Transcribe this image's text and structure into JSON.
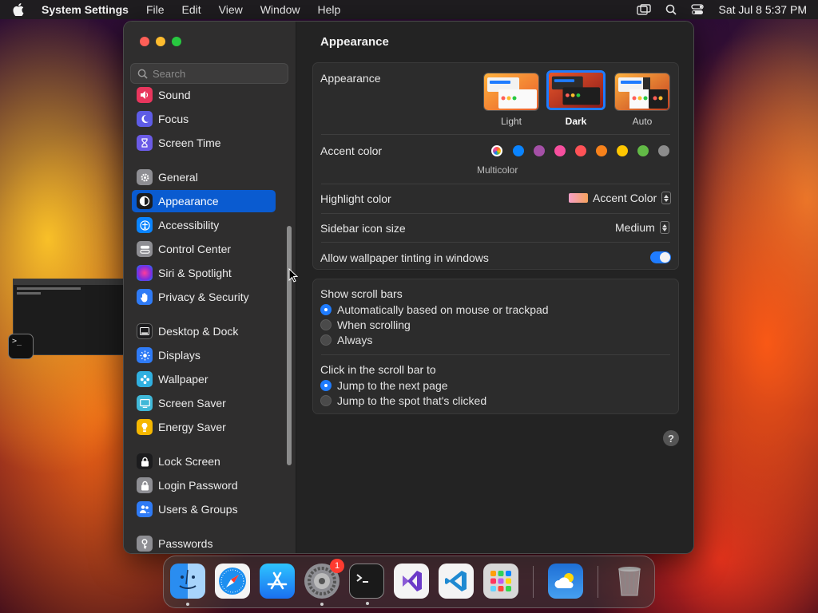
{
  "menubar": {
    "app_name": "System Settings",
    "items": [
      "File",
      "Edit",
      "View",
      "Window",
      "Help"
    ],
    "clock": "Sat Jul 8  5:37 PM"
  },
  "sidebar": {
    "search_placeholder": "Search",
    "items": [
      {
        "label": "Sound",
        "icon": "speaker-icon",
        "color": "#e8365d"
      },
      {
        "label": "Focus",
        "icon": "moon-icon",
        "color": "#5e5ce6"
      },
      {
        "label": "Screen Time",
        "icon": "hourglass-icon",
        "color": "#6b5be6"
      },
      {
        "label": "General",
        "icon": "gear-icon",
        "color": "#8e8e93"
      },
      {
        "label": "Appearance",
        "icon": "appearance-icon",
        "color": "#1c1c1e"
      },
      {
        "label": "Accessibility",
        "icon": "accessibility-icon",
        "color": "#0a84ff"
      },
      {
        "label": "Control Center",
        "icon": "control-center-icon",
        "color": "#8e8e93"
      },
      {
        "label": "Siri & Spotlight",
        "icon": "siri-icon",
        "color": "#b44cd6"
      },
      {
        "label": "Privacy & Security",
        "icon": "hand-icon",
        "color": "#2f7bf6"
      },
      {
        "label": "Desktop & Dock",
        "icon": "dock-icon",
        "color": "#1c1c1e"
      },
      {
        "label": "Displays",
        "icon": "displays-icon",
        "color": "#2f7bf6"
      },
      {
        "label": "Wallpaper",
        "icon": "wallpaper-icon",
        "color": "#30b0e0"
      },
      {
        "label": "Screen Saver",
        "icon": "screen-saver-icon",
        "color": "#40b8d8"
      },
      {
        "label": "Energy Saver",
        "icon": "battery-icon",
        "color": "#f5b700"
      },
      {
        "label": "Lock Screen",
        "icon": "lock-icon",
        "color": "#1c1c1e"
      },
      {
        "label": "Login Password",
        "icon": "lock-key-icon",
        "color": "#8e8e93"
      },
      {
        "label": "Users & Groups",
        "icon": "users-icon",
        "color": "#2f7bf6"
      },
      {
        "label": "Passwords",
        "icon": "key-icon",
        "color": "#8e8e93"
      }
    ],
    "selected": "Appearance"
  },
  "main": {
    "title": "Appearance",
    "appearance": {
      "label": "Appearance",
      "options": [
        "Light",
        "Dark",
        "Auto"
      ],
      "selected": "Dark"
    },
    "accent": {
      "label": "Accent color",
      "multicolor_label": "Multicolor",
      "colors": [
        "multicolor",
        "#0a84ff",
        "#a550a7",
        "#f74f9e",
        "#ff5257",
        "#f7821b",
        "#ffc600",
        "#62ba46",
        "#8c8c8c"
      ]
    },
    "highlight": {
      "label": "Highlight color",
      "value": "Accent Color"
    },
    "sidebar_icon_size": {
      "label": "Sidebar icon size",
      "value": "Medium"
    },
    "wallpaper_tinting": {
      "label": "Allow wallpaper tinting in windows",
      "enabled": true
    },
    "scroll_bars": {
      "label": "Show scroll bars",
      "options": [
        "Automatically based on mouse or trackpad",
        "When scrolling",
        "Always"
      ],
      "selected": 0
    },
    "click_scroll": {
      "label": "Click in the scroll bar to",
      "options": [
        "Jump to the next page",
        "Jump to the spot that's clicked"
      ],
      "selected": 0
    },
    "help": "?"
  },
  "dock": {
    "apps": [
      {
        "name": "Finder",
        "icon": "finder-icon",
        "running": true
      },
      {
        "name": "Safari",
        "icon": "safari-icon",
        "running": false
      },
      {
        "name": "App Store",
        "icon": "app-store-icon",
        "running": false
      },
      {
        "name": "System Settings",
        "icon": "system-settings-icon",
        "running": true,
        "badge": "1"
      },
      {
        "name": "Terminal",
        "icon": "terminal-icon",
        "running": true
      },
      {
        "name": "Visual Studio",
        "icon": "visual-studio-icon",
        "running": false
      },
      {
        "name": "VS Code",
        "icon": "vscode-icon",
        "running": false
      },
      {
        "name": "Launchpad",
        "icon": "launchpad-icon",
        "running": false
      },
      {
        "name": "Weather",
        "icon": "weather-icon",
        "running": false
      },
      {
        "name": "Trash",
        "icon": "trash-icon",
        "running": false
      }
    ]
  },
  "terminal_preview": {
    "prompt": ">_"
  }
}
